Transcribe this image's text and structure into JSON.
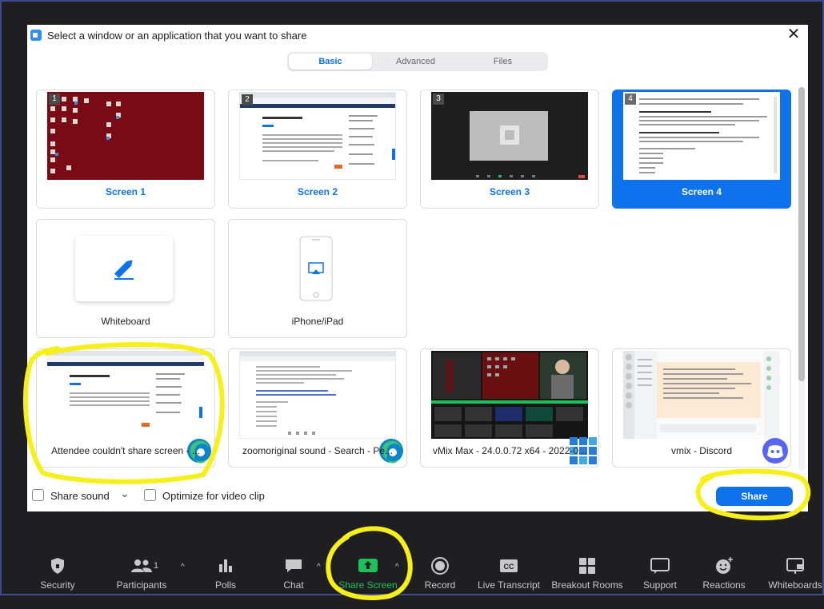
{
  "dialog": {
    "title": "Select a window or an application that you want to share",
    "close_glyph": "✕"
  },
  "tabs": [
    {
      "label": "Basic",
      "active": true
    },
    {
      "label": "Advanced",
      "active": false
    },
    {
      "label": "Files",
      "active": false
    }
  ],
  "tiles": [
    {
      "label": "Screen 1",
      "number": "1",
      "kind": "screen"
    },
    {
      "label": "Screen 2",
      "number": "2",
      "kind": "screen"
    },
    {
      "label": "Screen 3",
      "number": "3",
      "kind": "screen"
    },
    {
      "label": "Screen 4",
      "number": "4",
      "kind": "screen",
      "selected": true
    },
    {
      "label": "Whiteboard",
      "kind": "app",
      "icon": "pencil-icon"
    },
    {
      "label": "iPhone/iPad",
      "kind": "app",
      "icon": "airplay-phone-icon"
    },
    {
      "label": "Attendee couldn't share screen - ...",
      "kind": "window",
      "icon": "edge-icon"
    },
    {
      "label": "zoomoriginal sound - Search - Pe...",
      "kind": "window",
      "icon": "edge-icon"
    },
    {
      "label": "vMix Max - 24.0.0.72 x64 - 2022-0...",
      "kind": "window",
      "icon": "vmix-icon"
    },
    {
      "label": "vmix - Discord",
      "kind": "window",
      "icon": "discord-icon"
    }
  ],
  "options": {
    "share_sound": "Share sound",
    "optimize_video": "Optimize for video clip",
    "share_sound_caret": "⌄"
  },
  "share_button": "Share",
  "toolbar": {
    "participant_count": "1",
    "caret": "^",
    "items": [
      {
        "label": "Security",
        "icon": "shield-icon"
      },
      {
        "label": "Participants",
        "icon": "participants-icon"
      },
      {
        "label": "Polls",
        "icon": "polls-icon"
      },
      {
        "label": "Chat",
        "icon": "chat-icon"
      },
      {
        "label": "Share Screen",
        "icon": "share-screen-icon",
        "active": true
      },
      {
        "label": "Record",
        "icon": "record-icon"
      },
      {
        "label": "Live Transcript",
        "icon": "cc-icon"
      },
      {
        "label": "Breakout Rooms",
        "icon": "breakout-rooms-icon"
      },
      {
        "label": "Support",
        "icon": "support-icon"
      },
      {
        "label": "Reactions",
        "icon": "reactions-icon"
      },
      {
        "label": "Whiteboards",
        "icon": "whiteboards-icon"
      }
    ]
  },
  "colors": {
    "accent": "#0e72ed",
    "share_green": "#1ec05a",
    "annotation_yellow": "#f7ef1a",
    "toolbar_bg": "#1f1f22",
    "desktop_red": "#7a0a14"
  }
}
